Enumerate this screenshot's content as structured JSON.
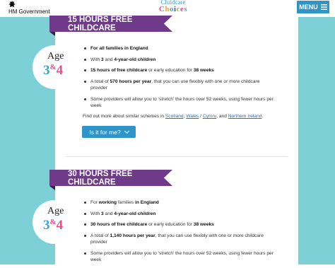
{
  "header": {
    "gov_label": "HM Government",
    "logo_line1": "Childcare",
    "logo_line2": [
      "C",
      "h",
      "o",
      "i",
      "c",
      "e",
      "s"
    ],
    "logo_colors": [
      "#e84c8b",
      "#f2a531",
      "#3aa6c9",
      "#6f3a8a",
      "#7cbf4c",
      "#e84c8b",
      "#3aa6c9"
    ],
    "menu_label": "MENU",
    "menu_icon": "hamburger-icon"
  },
  "sections": [
    {
      "banner": "15 HOURS FREE CHILDCARE",
      "age_label": "Age",
      "age_from": "3",
      "age_amp": "&",
      "age_to": "4",
      "bullets": [
        [
          {
            "t": "For all families in England",
            "b": true
          }
        ],
        [
          {
            "t": "With ",
            "b": false
          },
          {
            "t": "3",
            "b": true
          },
          {
            "t": " and ",
            "b": false
          },
          {
            "t": "4-year-old children",
            "b": true
          }
        ],
        [
          {
            "t": "15 hours of free childcare",
            "b": true
          },
          {
            "t": " or early education for ",
            "b": false
          },
          {
            "t": "38 weeks",
            "b": true
          }
        ],
        [
          {
            "t": "A total of ",
            "b": false
          },
          {
            "t": "570 hours per year",
            "b": true
          },
          {
            "t": ", that you can use flexibly with one or more childcare provider",
            "b": false
          }
        ],
        [
          {
            "t": "Some providers will allow you  to ‘stretch’ the hours over 52 weeks, using fewer hours per week",
            "b": false
          }
        ]
      ],
      "find_out": {
        "prefix": "Find out more about similar schemes in ",
        "scotland": "Scotland",
        "sep1": ", ",
        "wales": "Wales",
        "slash": " / ",
        "cymru": "Cymru",
        "sep2": ", and ",
        "ni": "Northern Ireland",
        "suffix": "."
      },
      "button_label": "Is it for me?"
    },
    {
      "banner": "30 HOURS FREE CHILDCARE",
      "age_label": "Age",
      "age_from": "3",
      "age_amp": "&",
      "age_to": "4",
      "bullets": [
        [
          {
            "t": "For ",
            "b": false
          },
          {
            "t": "working",
            "b": true
          },
          {
            "t": " families ",
            "b": false
          },
          {
            "t": "in England",
            "b": true
          }
        ],
        [
          {
            "t": "With ",
            "b": false
          },
          {
            "t": "3",
            "b": true
          },
          {
            "t": " and ",
            "b": false
          },
          {
            "t": "4-year-old children",
            "b": true
          }
        ],
        [
          {
            "t": "30 hours of free childcare",
            "b": true
          },
          {
            "t": " or early education for ",
            "b": false
          },
          {
            "t": "38 weeks",
            "b": true
          }
        ],
        [
          {
            "t": "A total of ",
            "b": false
          },
          {
            "t": "1,140 hours per year",
            "b": true
          },
          {
            "t": ", that you can use flexibly with one or more childcare provider",
            "b": false
          }
        ],
        [
          {
            "t": "Some providers will allow you  to ‘stretch’ the hours over 52 weeks, using fewer hours per week",
            "b": false
          }
        ]
      ]
    }
  ],
  "colors": {
    "accent_blue": "#2f94c8",
    "banner_purple": "#6f3a8a",
    "side_teal": "#7cd0d6",
    "age_blue": "#3aa6c9",
    "age_pink": "#e84c8b"
  }
}
